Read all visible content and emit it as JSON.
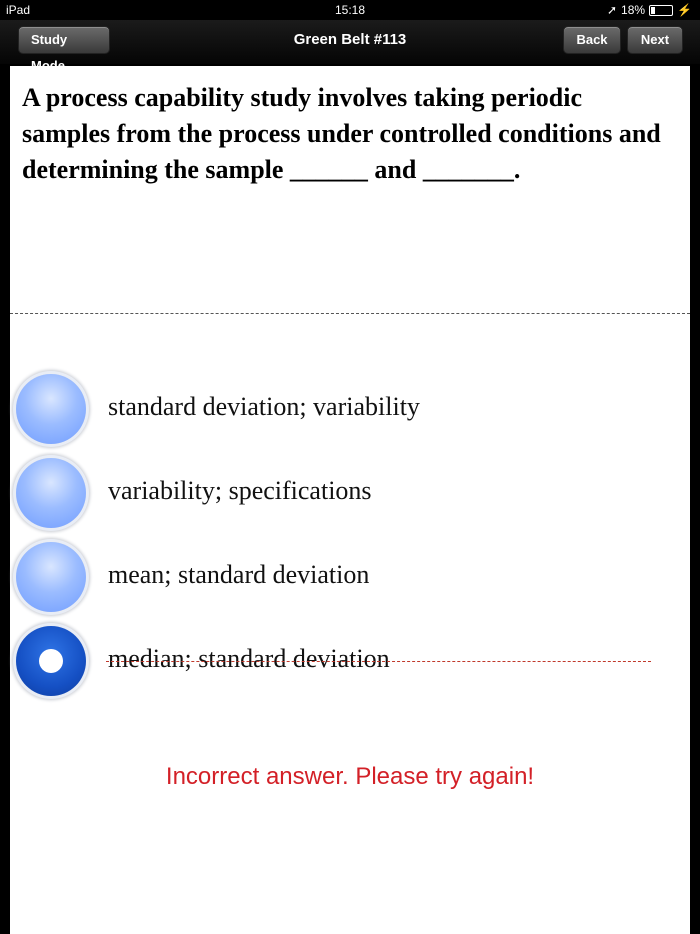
{
  "status_bar": {
    "device": "iPad",
    "time": "15:18",
    "battery": "18%"
  },
  "nav": {
    "title": "Green Belt #113",
    "study_mode_label": "Study Mode",
    "back_label": "Back",
    "next_label": "Next"
  },
  "question": {
    "text": "A process capability study involves taking periodic samples from the process under controlled conditions and determining the sample ______ and _______."
  },
  "options": [
    {
      "label": "standard deviation; variability",
      "selected": false
    },
    {
      "label": "variability; specifications",
      "selected": false
    },
    {
      "label": "mean; standard deviation",
      "selected": false
    },
    {
      "label": "median; standard deviation",
      "selected": true,
      "struck_out": true
    }
  ],
  "feedback": {
    "text": "Incorrect answer. Please try again!",
    "color": "#d32027"
  },
  "colors": {
    "radio_unselected": "#9bbcff",
    "radio_selected": "#1550c4",
    "strike_line": "#c0392b"
  }
}
